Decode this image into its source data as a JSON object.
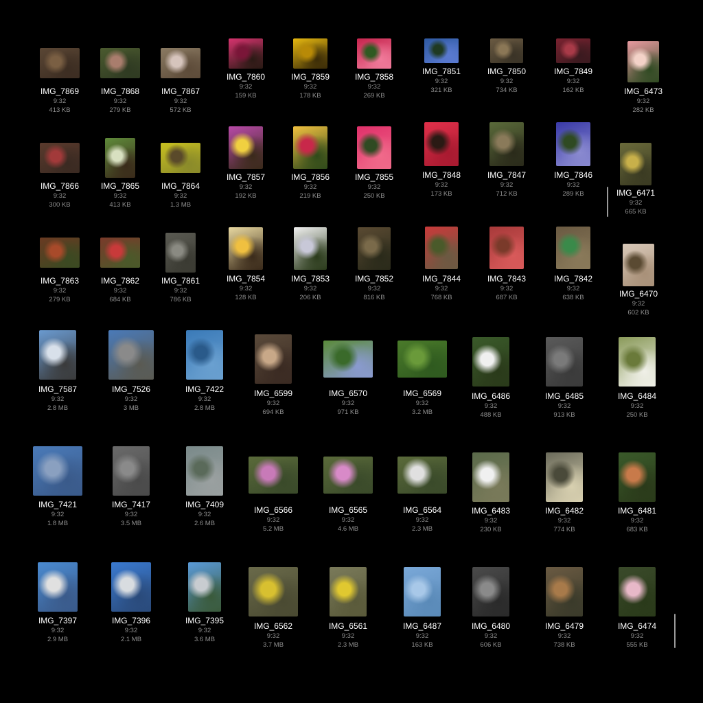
{
  "files": [
    {
      "name": "IMG_7869",
      "time": "9:32",
      "size": "413 KB",
      "colors": [
        "#5a4634",
        "#7a5f43",
        "#3c2d22"
      ]
    },
    {
      "name": "IMG_7868",
      "time": "9:32",
      "size": "279 KB",
      "colors": [
        "#4b5a2f",
        "#a97d6d",
        "#2f3a22"
      ]
    },
    {
      "name": "IMG_7867",
      "time": "9:32",
      "size": "572 KB",
      "colors": [
        "#8a7a62",
        "#d6c4bc",
        "#5d4b39"
      ]
    },
    {
      "name": "IMG_7860",
      "time": "9:32",
      "size": "159 KB",
      "colors": [
        "#d6336e",
        "#7a1638",
        "#2a1a14"
      ]
    },
    {
      "name": "IMG_7859",
      "time": "9:32",
      "size": "178 KB",
      "colors": [
        "#e5b710",
        "#b88a07",
        "#3b2c08"
      ]
    },
    {
      "name": "IMG_7858",
      "time": "9:32",
      "size": "269 KB",
      "colors": [
        "#c7254e",
        "#2f5a22",
        "#f07a9a"
      ]
    },
    {
      "name": "IMG_7851",
      "time": "9:32",
      "size": "321 KB",
      "colors": [
        "#2f5aa2",
        "#1f3a22",
        "#5a7ad0"
      ]
    },
    {
      "name": "IMG_7850",
      "time": "9:32",
      "size": "734 KB",
      "colors": [
        "#6a5a42",
        "#8b7756",
        "#3a3326"
      ]
    },
    {
      "name": "IMG_7849",
      "time": "9:32",
      "size": "162 KB",
      "colors": [
        "#7a2230",
        "#a83a48",
        "#3a1a1f"
      ]
    },
    {
      "name": "IMG_6473",
      "time": "9:32",
      "size": "282 KB",
      "colors": [
        "#e89aa0",
        "#f3d2c8",
        "#2f4a22"
      ]
    },
    {
      "name": "IMG_7866",
      "time": "9:32",
      "size": "300 KB",
      "colors": [
        "#5a3a2c",
        "#a23a3a",
        "#3a2a22"
      ]
    },
    {
      "name": "IMG_7865",
      "time": "9:32",
      "size": "413 KB",
      "colors": [
        "#5f8a3a",
        "#d8e0c0",
        "#3a2a1a"
      ]
    },
    {
      "name": "IMG_7864",
      "time": "9:32",
      "size": "1.3 MB",
      "colors": [
        "#c8c020",
        "#5a4a2a",
        "#8a8a2a"
      ]
    },
    {
      "name": "IMG_7857",
      "time": "9:32",
      "size": "192 KB",
      "colors": [
        "#b84aa8",
        "#f0d040",
        "#3a2a1a"
      ]
    },
    {
      "name": "IMG_7856",
      "time": "9:32",
      "size": "219 KB",
      "colors": [
        "#f0c040",
        "#c8284a",
        "#2f4a1a"
      ]
    },
    {
      "name": "IMG_7855",
      "time": "9:32",
      "size": "250 KB",
      "colors": [
        "#e0306a",
        "#2f4a22",
        "#f06a8a"
      ]
    },
    {
      "name": "IMG_7848",
      "time": "9:32",
      "size": "173 KB",
      "colors": [
        "#e0304a",
        "#2a1a14",
        "#a81a30"
      ]
    },
    {
      "name": "IMG_7847",
      "time": "9:32",
      "size": "712 KB",
      "colors": [
        "#5a6a3a",
        "#8a7a5a",
        "#2a2a1a"
      ]
    },
    {
      "name": "IMG_7846",
      "time": "9:32",
      "size": "289 KB",
      "colors": [
        "#3a3aa8",
        "#2f4a22",
        "#8a8ad0"
      ]
    },
    {
      "name": "IMG_6471",
      "time": "9:32",
      "size": "665 KB",
      "colors": [
        "#6a6a3a",
        "#c8b04a",
        "#3a3a22"
      ]
    },
    {
      "name": "IMG_7863",
      "time": "9:32",
      "size": "279 KB",
      "colors": [
        "#6a3a22",
        "#a84a2a",
        "#3a4a22"
      ]
    },
    {
      "name": "IMG_7862",
      "time": "9:32",
      "size": "684 KB",
      "colors": [
        "#7a3a2a",
        "#c83a3a",
        "#4a5a2a"
      ]
    },
    {
      "name": "IMG_7861",
      "time": "9:32",
      "size": "786 KB",
      "colors": [
        "#5a5a52",
        "#8a8a82",
        "#3a3a32"
      ]
    },
    {
      "name": "IMG_7854",
      "time": "9:32",
      "size": "128 KB",
      "colors": [
        "#e8d8a0",
        "#f0c040",
        "#3a2a1a"
      ]
    },
    {
      "name": "IMG_7853",
      "time": "9:32",
      "size": "206 KB",
      "colors": [
        "#f0f0f0",
        "#c8c8d8",
        "#2a3a1a"
      ]
    },
    {
      "name": "IMG_7852",
      "time": "9:32",
      "size": "816 KB",
      "colors": [
        "#5a4a32",
        "#7a6a4a",
        "#2a2a1a"
      ]
    },
    {
      "name": "IMG_7844",
      "time": "9:32",
      "size": "768 KB",
      "colors": [
        "#c83a3a",
        "#4a5a2a",
        "#6a5a42"
      ]
    },
    {
      "name": "IMG_7843",
      "time": "9:32",
      "size": "687 KB",
      "colors": [
        "#a83a3a",
        "#7a3a2a",
        "#d85a5a"
      ]
    },
    {
      "name": "IMG_7842",
      "time": "9:32",
      "size": "638 KB",
      "colors": [
        "#6a5a42",
        "#3a8a4a",
        "#8a7a5a"
      ]
    },
    {
      "name": "IMG_6470",
      "time": "9:32",
      "size": "602 KB",
      "colors": [
        "#d8c8b8",
        "#5a4a32",
        "#a89078"
      ]
    },
    {
      "name": "IMG_7587",
      "time": "9:32",
      "size": "2.8 MB",
      "colors": [
        "#6a9ad0",
        "#d8e0ea",
        "#3a3a3a"
      ]
    },
    {
      "name": "IMG_7526",
      "time": "9:32",
      "size": "3 MB",
      "colors": [
        "#4a7ab8",
        "#8a8a8a",
        "#5a5a52"
      ]
    },
    {
      "name": "IMG_7422",
      "time": "9:32",
      "size": "2.8 MB",
      "colors": [
        "#3a7ab8",
        "#2a5a8a",
        "#6aa0d0"
      ]
    },
    {
      "name": "IMG_6599",
      "time": "9:32",
      "size": "694 KB",
      "colors": [
        "#5a4a3a",
        "#c8a888",
        "#3a2a22"
      ]
    },
    {
      "name": "IMG_6570",
      "time": "9:32",
      "size": "971 KB",
      "colors": [
        "#5a8a3a",
        "#3a6a2a",
        "#8a9ad0"
      ]
    },
    {
      "name": "IMG_6569",
      "time": "9:32",
      "size": "3.2 MB",
      "colors": [
        "#4a7a2a",
        "#6a9a3a",
        "#2f5a1f"
      ]
    },
    {
      "name": "IMG_6486",
      "time": "9:32",
      "size": "488 KB",
      "colors": [
        "#3a5a2a",
        "#f0f0f0",
        "#2a3a1a"
      ]
    },
    {
      "name": "IMG_6485",
      "time": "9:32",
      "size": "913 KB",
      "colors": [
        "#5a5a5a",
        "#7a7a7a",
        "#3a3a3a"
      ]
    },
    {
      "name": "IMG_6484",
      "time": "9:32",
      "size": "250 KB",
      "colors": [
        "#8a9a5a",
        "#6a7a3a",
        "#f0f0e8"
      ]
    },
    {
      "name": "IMG_7421",
      "time": "9:32",
      "size": "1.8 MB",
      "colors": [
        "#4a7ab8",
        "#8aa0c0",
        "#3a5a8a"
      ]
    },
    {
      "name": "IMG_7417",
      "time": "9:32",
      "size": "3.5 MB",
      "colors": [
        "#6a6a6a",
        "#8a8a8a",
        "#4a4a4a"
      ]
    },
    {
      "name": "IMG_7409",
      "time": "9:32",
      "size": "2.6 MB",
      "colors": [
        "#7a8a8a",
        "#5a6a5a",
        "#9aa0a0"
      ]
    },
    {
      "name": "IMG_6566",
      "time": "9:32",
      "size": "5.2 MB",
      "colors": [
        "#5a6a3a",
        "#c87ab8",
        "#3a4a2a"
      ]
    },
    {
      "name": "IMG_6565",
      "time": "9:32",
      "size": "4.6 MB",
      "colors": [
        "#5a6a3a",
        "#d88ac8",
        "#3a4a2a"
      ]
    },
    {
      "name": "IMG_6564",
      "time": "9:32",
      "size": "2.3 MB",
      "colors": [
        "#5a6a3a",
        "#e0e0e0",
        "#3a4a2a"
      ]
    },
    {
      "name": "IMG_6483",
      "time": "9:32",
      "size": "230 KB",
      "colors": [
        "#5a6a4a",
        "#f0f0f0",
        "#7a7a5a"
      ]
    },
    {
      "name": "IMG_6482",
      "time": "9:32",
      "size": "774 KB",
      "colors": [
        "#6a6a5a",
        "#4a4a3a",
        "#d8d0b0"
      ]
    },
    {
      "name": "IMG_6481",
      "time": "9:32",
      "size": "683 KB",
      "colors": [
        "#3a5a2a",
        "#c87a4a",
        "#2a3a1a"
      ]
    },
    {
      "name": "IMG_7397",
      "time": "9:32",
      "size": "2.9 MB",
      "colors": [
        "#4a8ad0",
        "#e0e0e0",
        "#3a5a8a"
      ]
    },
    {
      "name": "IMG_7396",
      "time": "9:32",
      "size": "2.1 MB",
      "colors": [
        "#3a7ad0",
        "#d8dce0",
        "#2a4a7a"
      ]
    },
    {
      "name": "IMG_7395",
      "time": "9:32",
      "size": "3.6 MB",
      "colors": [
        "#5a9ad8",
        "#c8ccd0",
        "#3a5a3a"
      ]
    },
    {
      "name": "IMG_6562",
      "time": "9:32",
      "size": "3.7 MB",
      "colors": [
        "#6a6a4a",
        "#d8c030",
        "#4a4a32"
      ]
    },
    {
      "name": "IMG_6561",
      "time": "9:32",
      "size": "2.3 MB",
      "colors": [
        "#7a7a5a",
        "#e0c830",
        "#5a5a3a"
      ]
    },
    {
      "name": "IMG_6487",
      "time": "9:32",
      "size": "163 KB",
      "colors": [
        "#7aa8d8",
        "#a8c8e8",
        "#5a8ab8"
      ]
    },
    {
      "name": "IMG_6480",
      "time": "9:32",
      "size": "606 KB",
      "colors": [
        "#4a4a4a",
        "#8a8a8a",
        "#2a2a2a"
      ]
    },
    {
      "name": "IMG_6479",
      "time": "9:32",
      "size": "738 KB",
      "colors": [
        "#6a5a42",
        "#a87a4a",
        "#3a3a2a"
      ]
    },
    {
      "name": "IMG_6474",
      "time": "9:32",
      "size": "555 KB",
      "colors": [
        "#3a4a2a",
        "#e8b8c8",
        "#2a3a1a"
      ]
    }
  ]
}
